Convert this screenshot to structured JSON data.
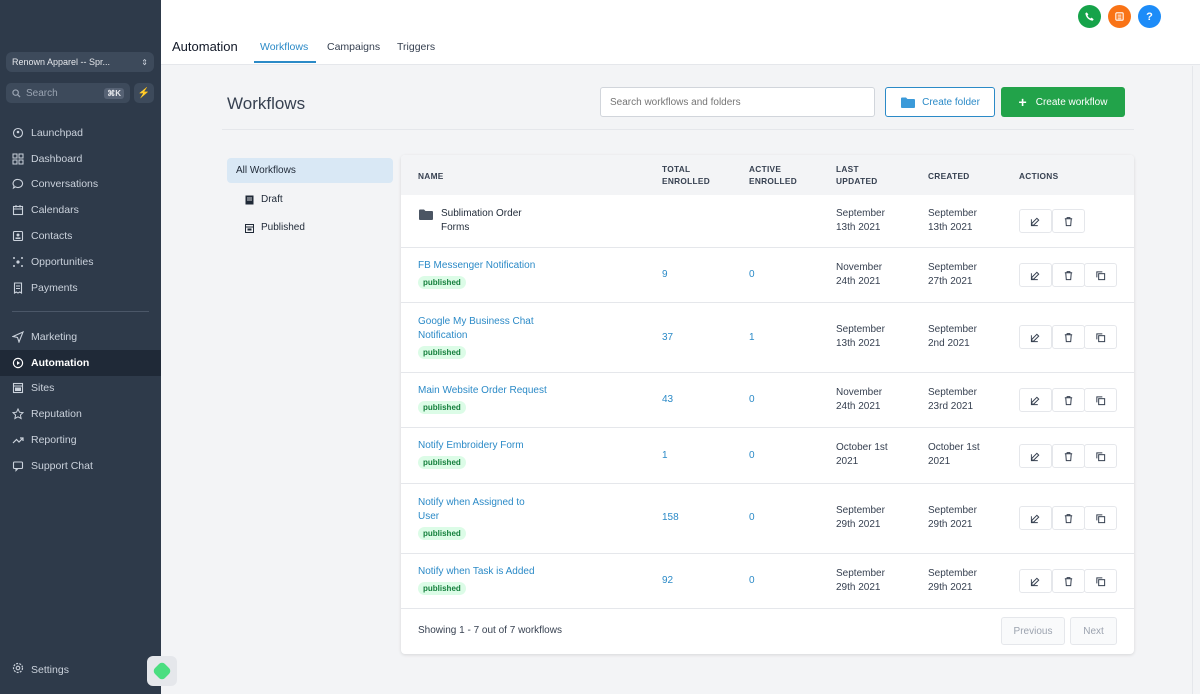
{
  "sidebar": {
    "account": "Renown Apparel -- Spr...",
    "search_placeholder": "Search",
    "search_shortcut": "⌘K",
    "items": [
      {
        "label": "Launchpad"
      },
      {
        "label": "Dashboard"
      },
      {
        "label": "Conversations"
      },
      {
        "label": "Calendars"
      },
      {
        "label": "Contacts"
      },
      {
        "label": "Opportunities"
      },
      {
        "label": "Payments"
      },
      {
        "label": "Marketing"
      },
      {
        "label": "Automation"
      },
      {
        "label": "Sites"
      },
      {
        "label": "Reputation"
      },
      {
        "label": "Reporting"
      },
      {
        "label": "Support Chat"
      }
    ],
    "settings": "Settings"
  },
  "header": {
    "title": "Automation",
    "tabs": [
      {
        "label": "Workflows"
      },
      {
        "label": "Campaigns"
      },
      {
        "label": "Triggers"
      }
    ],
    "help_label": "?"
  },
  "colors": {
    "accent": "#2b8ac7",
    "create": "#22a34a",
    "phone": "#16a34a",
    "notif": "#f97316",
    "help": "#1d8cf8"
  },
  "main": {
    "title": "Workflows",
    "search_placeholder": "Search workflows and folders",
    "create_folder": "Create folder",
    "create_workflow": "Create workflow"
  },
  "filters": [
    {
      "label": "All Workflows"
    },
    {
      "label": "Draft"
    },
    {
      "label": "Published"
    }
  ],
  "table": {
    "headers": {
      "name": "NAME",
      "total_1": "TOTAL",
      "total_2": "ENROLLED",
      "active_1": "ACTIVE",
      "active_2": "ENROLLED",
      "updated_1": "LAST",
      "updated_2": "UPDATED",
      "created": "CREATED",
      "actions": "ACTIONS"
    },
    "rows": [
      {
        "name_1": "Sublimation Order",
        "name_2": "Forms",
        "updated_1": "September",
        "updated_2": "13th 2021",
        "created_1": "September",
        "created_2": "13th 2021"
      },
      {
        "name_1": "FB Messenger Notification",
        "status": "published",
        "total": "9",
        "active": "0",
        "updated_1": "November",
        "updated_2": "24th 2021",
        "created_1": "September",
        "created_2": "27th 2021"
      },
      {
        "name_1": "Google My Business Chat",
        "name_2": "Notification",
        "status": "published",
        "total": "37",
        "active": "1",
        "updated_1": "September",
        "updated_2": "13th 2021",
        "created_1": "September",
        "created_2": "2nd 2021"
      },
      {
        "name_1": "Main Website Order Request",
        "status": "published",
        "total": "43",
        "active": "0",
        "updated_1": "November",
        "updated_2": "24th 2021",
        "created_1": "September",
        "created_2": "23rd 2021"
      },
      {
        "name_1": "Notify Embroidery Form",
        "status": "published",
        "total": "1",
        "active": "0",
        "updated_1": "October 1st",
        "updated_2": "2021",
        "created_1": "October 1st",
        "created_2": "2021"
      },
      {
        "name_1": "Notify when Assigned to",
        "name_2": "User",
        "status": "published",
        "total": "158",
        "active": "0",
        "updated_1": "September",
        "updated_2": "29th 2021",
        "created_1": "September",
        "created_2": "29th 2021"
      },
      {
        "name_1": "Notify when Task is Added",
        "status": "published",
        "total": "92",
        "active": "0",
        "updated_1": "September",
        "updated_2": "29th 2021",
        "created_1": "September",
        "created_2": "29th 2021"
      }
    ],
    "footer": "Showing 1 - 7 out of 7 workflows",
    "previous": "Previous",
    "next": "Next"
  }
}
